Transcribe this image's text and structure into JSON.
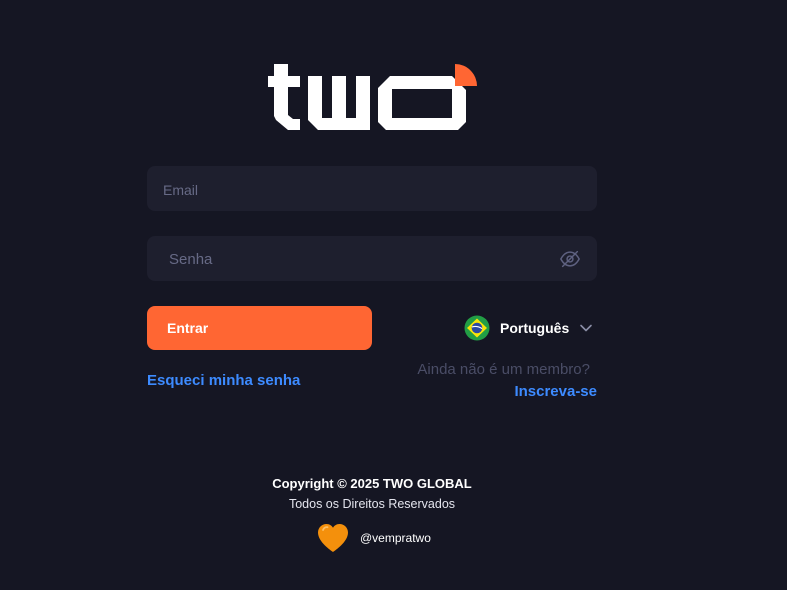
{
  "brand": {
    "name": "two",
    "accent_color": "#ff6633",
    "background_color": "#151623"
  },
  "login": {
    "email_placeholder": "Email",
    "password_placeholder": "Senha",
    "password_toggle_icon": "eye-off-icon",
    "submit_label": "Entrar",
    "forgot_password_label": "Esqueci minha senha"
  },
  "language": {
    "selected": "Português",
    "flag_icon": "brazil-flag-icon"
  },
  "signup": {
    "prompt": "Ainda não é um membro?",
    "link_label": "Inscreva-se"
  },
  "footer": {
    "copyright": "Copyright © 2025 TWO GLOBAL",
    "rights": "Todos os Direitos Reservados",
    "social_icon": "orange-heart-icon",
    "social_handle": "@vempratwo"
  }
}
